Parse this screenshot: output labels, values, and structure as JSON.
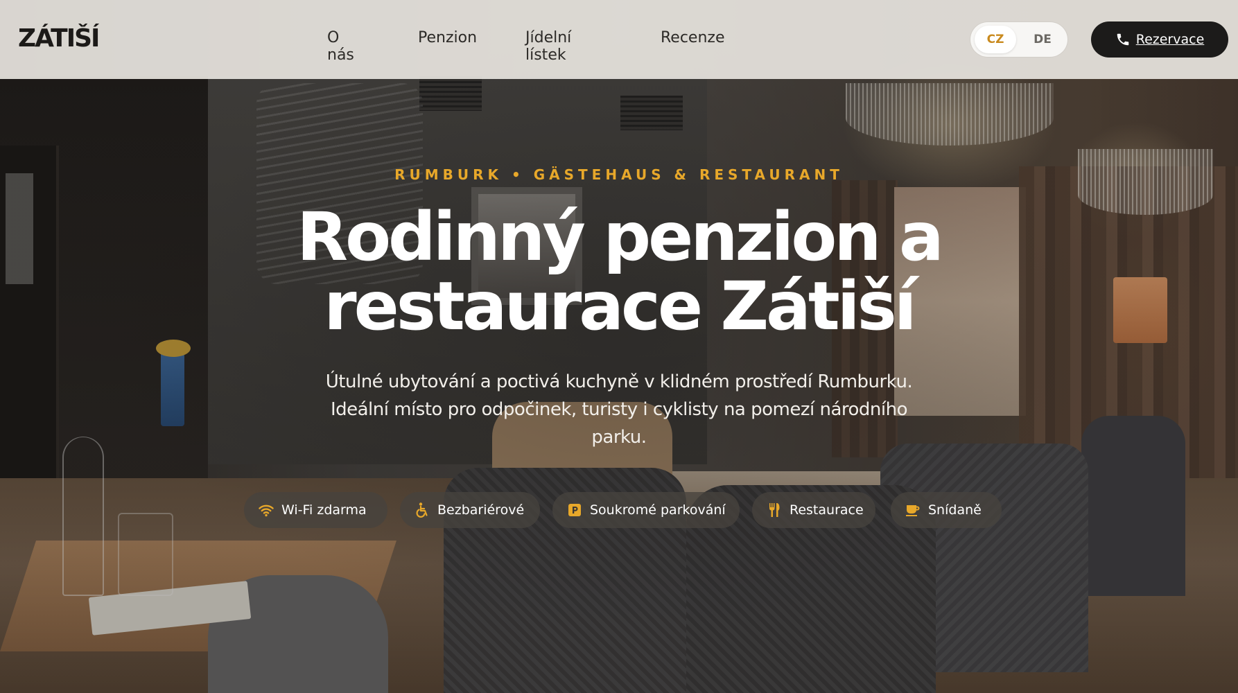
{
  "header": {
    "logo": "ZÁTIŠÍ",
    "nav": [
      "O nás",
      "Penzion",
      "Jídelní lístek",
      "Recenze"
    ],
    "languages": [
      "CZ",
      "DE"
    ],
    "active_language": "CZ",
    "reserve_label": "Rezervace",
    "reserve_icon": "phone-icon"
  },
  "hero": {
    "eyebrow": "RUMBURK • GÄSTEHAUS & RESTAURANT",
    "title_line1": "Rodinný penzion a",
    "title_line2": "restaurace Zátiší",
    "subtitle": "Útulné ubytování a poctivá kuchyně v klidném prostředí Rumburku. Ideální místo pro odpočinek, turisty i cyklisty na pomezí národního parku.",
    "amenities": [
      {
        "label": "Wi-Fi zdarma",
        "icon": "wifi-icon"
      },
      {
        "label": "Bezbariérové",
        "icon": "wheelchair-icon"
      },
      {
        "label": "Soukromé parkování",
        "icon": "parking-icon"
      },
      {
        "label": "Restaurace",
        "icon": "utensils-icon"
      },
      {
        "label": "Snídaně",
        "icon": "coffee-icon"
      }
    ]
  },
  "colors": {
    "accent": "#e8a82a",
    "header_bg": "#e8e5e0",
    "button_dark": "#1c1b1a",
    "lang_active": "#c98a1e"
  }
}
